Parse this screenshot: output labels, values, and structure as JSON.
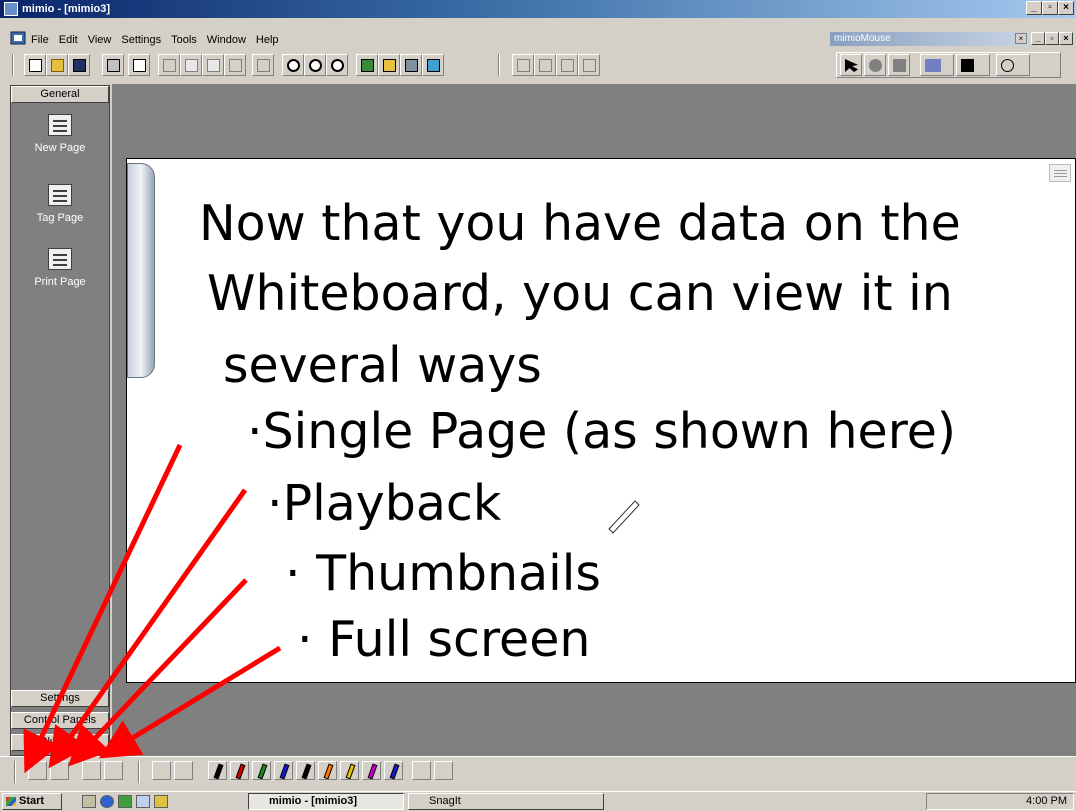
{
  "window": {
    "title": "mimio - [mimio3]"
  },
  "menu": [
    "File",
    "Edit",
    "View",
    "Settings",
    "Tools",
    "Window",
    "Help"
  ],
  "mimio_mouse": {
    "title": "mimioMouse"
  },
  "sidebar": {
    "header": "General",
    "items": [
      {
        "label": "New Page",
        "icon": "new-page-icon"
      },
      {
        "label": "Tag Page",
        "icon": "tag-page-icon"
      },
      {
        "label": "Print Page",
        "icon": "print-icon"
      }
    ],
    "footer_tabs": [
      "Settings",
      "Control Panels",
      "Plug-ins"
    ]
  },
  "whiteboard": {
    "lines": [
      "Now that you have data on the",
      "Whiteboard, you can view it in",
      "several ways",
      "·Single Page (as shown here)",
      "·Playback",
      "· Thumbnails",
      "· Full screen"
    ]
  },
  "taskbar": {
    "start": "Start",
    "tasks": [
      "mimio - [mimio3]",
      "SnagIt"
    ],
    "clock": "4:00 PM"
  },
  "colors": {
    "title_start": "#0a246a",
    "arrow": "#ff0000",
    "pens": [
      "#000000",
      "#cc0000",
      "#1a8a1a",
      "#1a1acc",
      "#000000",
      "#ff7700",
      "#e0c000",
      "#cc00cc",
      "#1a1acc"
    ]
  }
}
